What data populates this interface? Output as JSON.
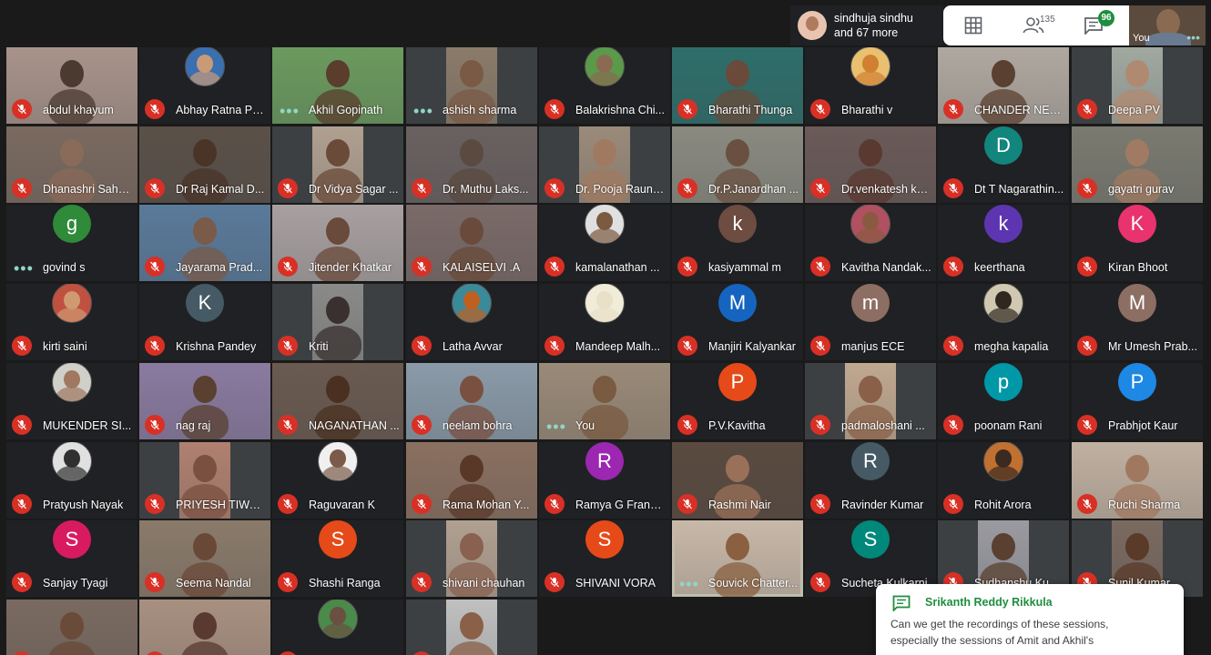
{
  "topbar": {
    "presenter_name": "sindhuja sindhu",
    "presenter_more": "and 67 more",
    "participants_count": "135",
    "chat_badge": "96",
    "self_label": "You"
  },
  "colors": {
    "mic_off": "#d93025",
    "speaking_outline": "#8fd6c6",
    "chat_green": "#1e8e3e"
  },
  "tiles": [
    {
      "name": "abdul khayum",
      "status": "muted",
      "kind": "video",
      "bg": "#a8938a",
      "skin": "#4a3a30"
    },
    {
      "name": "Abhay Ratna Pa...",
      "status": "muted",
      "kind": "image",
      "fg": "#c99a78",
      "bg": "#3a6fb0"
    },
    {
      "name": "Akhil Gopinath",
      "status": "active",
      "kind": "video",
      "bg": "#6b9a5e",
      "skin": "#5a3d2c"
    },
    {
      "name": "ashish sharma",
      "status": "active",
      "kind": "video",
      "bg": "#8a7b6a",
      "skin": "#7a5a45",
      "narrow": true
    },
    {
      "name": "Balakrishna Chi...",
      "status": "muted",
      "kind": "image",
      "fg": "#8a6a50",
      "bg": "#5a9a4a"
    },
    {
      "name": "Bharathi Thunga",
      "status": "muted",
      "kind": "video",
      "bg": "#2e6e6a",
      "skin": "#6a4a3a"
    },
    {
      "name": "Bharathi v",
      "status": "muted",
      "kind": "image",
      "fg": "#d08030",
      "bg": "#e8c070"
    },
    {
      "name": "CHANDER NEN...",
      "status": "muted",
      "kind": "video",
      "bg": "#b0a8a0",
      "skin": "#5a4030"
    },
    {
      "name": "Deepa PV",
      "status": "muted",
      "kind": "video",
      "bg": "#a0a8a0",
      "skin": "#b08a70",
      "narrow": true
    },
    {
      "name": "Dhanashri Saha...",
      "status": "muted",
      "kind": "video",
      "bg": "#7a6a60",
      "skin": "#8a6a58"
    },
    {
      "name": "Dr Raj Kamal D...",
      "status": "muted",
      "kind": "video",
      "bg": "#5a5048",
      "skin": "#4a3428"
    },
    {
      "name": "Dr Vidya Sagar ...",
      "status": "muted",
      "kind": "video",
      "bg": "#b0a090",
      "skin": "#6a4a38",
      "narrow": true
    },
    {
      "name": "Dr. Muthu Laks...",
      "status": "muted",
      "kind": "video",
      "bg": "#6a6060",
      "skin": "#5a4a40"
    },
    {
      "name": "Dr. Pooja Raund...",
      "status": "muted",
      "kind": "video",
      "bg": "#9a8a7a",
      "skin": "#a07a60",
      "narrow": true
    },
    {
      "name": "Dr.P.Janardhan ...",
      "status": "muted",
      "kind": "video",
      "bg": "#8a8a80",
      "skin": "#6a5040"
    },
    {
      "name": "Dr.venkatesh ku...",
      "status": "muted",
      "kind": "video",
      "bg": "#6a5a58",
      "skin": "#5a3a30"
    },
    {
      "name": "Dt T Nagarathin...",
      "status": "muted",
      "kind": "letter",
      "letter": "D",
      "color": "#12857d"
    },
    {
      "name": "gayatri gurav",
      "status": "muted",
      "kind": "video",
      "bg": "#7a7a70",
      "skin": "#a07a62"
    },
    {
      "name": "govind s",
      "status": "active",
      "kind": "letter",
      "letter": "g",
      "color": "#2f8a3a"
    },
    {
      "name": "Jayarama Prad...",
      "status": "muted",
      "kind": "video",
      "bg": "#5a7a9a",
      "skin": "#7a5a48"
    },
    {
      "name": "Jitender Khatkar",
      "status": "muted",
      "kind": "video",
      "bg": "#a8a0a0",
      "skin": "#6a4a3a"
    },
    {
      "name": "KALAISELVI .A",
      "status": "muted",
      "kind": "video",
      "bg": "#7a6a68",
      "skin": "#6a4a3a"
    },
    {
      "name": "kamalanathan ...",
      "status": "muted",
      "kind": "image",
      "fg": "#7a5a40",
      "bg": "#e0e0e0"
    },
    {
      "name": "kasiyammal m",
      "status": "muted",
      "kind": "letter",
      "letter": "k",
      "color": "#6d4c41"
    },
    {
      "name": "Kavitha Nandak...",
      "status": "muted",
      "kind": "image",
      "fg": "#8a5a40",
      "bg": "#b05060"
    },
    {
      "name": "keerthana",
      "status": "muted",
      "kind": "letter",
      "letter": "k",
      "color": "#5e35b1"
    },
    {
      "name": "Kiran Bhoot",
      "status": "muted",
      "kind": "letter",
      "letter": "K",
      "color": "#e8336e"
    },
    {
      "name": "kirti saini",
      "status": "muted",
      "kind": "image",
      "fg": "#d09a70",
      "bg": "#c05040"
    },
    {
      "name": "Krishna Pandey",
      "status": "muted",
      "kind": "letter",
      "letter": "K",
      "color": "#455a64"
    },
    {
      "name": "Kriti",
      "status": "muted",
      "kind": "video",
      "bg": "#8a8a88",
      "skin": "#3a3030",
      "narrow": true
    },
    {
      "name": "Latha Avvar",
      "status": "muted",
      "kind": "image",
      "fg": "#c06020",
      "bg": "#3a8a9a"
    },
    {
      "name": "Mandeep Malh...",
      "status": "muted",
      "kind": "image",
      "fg": "#e8e0c8",
      "bg": "#f0ecd8"
    },
    {
      "name": "Manjiri Kalyankar",
      "status": "muted",
      "kind": "letter",
      "letter": "M",
      "color": "#1565c0"
    },
    {
      "name": "manjus ECE",
      "status": "muted",
      "kind": "letter",
      "letter": "m",
      "color": "#8d6e63"
    },
    {
      "name": "megha kapalia",
      "status": "muted",
      "kind": "image",
      "fg": "#302820",
      "bg": "#d0c8b0"
    },
    {
      "name": "Mr Umesh Prab...",
      "status": "muted",
      "kind": "letter",
      "letter": "M",
      "color": "#8d6e63"
    },
    {
      "name": "MUKENDER SI...",
      "status": "muted",
      "kind": "image",
      "fg": "#a07860",
      "bg": "#d0d0c8"
    },
    {
      "name": "nag raj",
      "status": "muted",
      "kind": "video",
      "bg": "#8a7aa0",
      "skin": "#5a4030"
    },
    {
      "name": "NAGANATHAN ...",
      "status": "muted",
      "kind": "video",
      "bg": "#6a5a50",
      "skin": "#4a3020"
    },
    {
      "name": "neelam bohra",
      "status": "muted",
      "kind": "video",
      "bg": "#8a9aa8",
      "skin": "#7a5040"
    },
    {
      "name": "You",
      "status": "active",
      "kind": "video",
      "bg": "#9a8a78",
      "skin": "#7a5a40"
    },
    {
      "name": "P.V.Kavitha",
      "status": "muted",
      "kind": "letter",
      "letter": "P",
      "color": "#e64a19"
    },
    {
      "name": "padmaloshani ...",
      "status": "muted",
      "kind": "video",
      "bg": "#c0a890",
      "skin": "#8a6048",
      "narrow": true
    },
    {
      "name": "poonam Rani",
      "status": "muted",
      "kind": "letter",
      "letter": "p",
      "color": "#0097a7"
    },
    {
      "name": "Prabhjot Kaur",
      "status": "muted",
      "kind": "letter",
      "letter": "P",
      "color": "#1e88e5"
    },
    {
      "name": "Pratyush Nayak",
      "status": "muted",
      "kind": "image",
      "fg": "#303030",
      "bg": "#e0e0e0"
    },
    {
      "name": "PRIYESH TIWARI",
      "status": "muted",
      "kind": "video",
      "bg": "#b08070",
      "skin": "#7a5040",
      "narrow": true
    },
    {
      "name": "Raguvaran K",
      "status": "muted",
      "kind": "image",
      "fg": "#7a5a48",
      "bg": "#f0f0f0"
    },
    {
      "name": "Rama Mohan Y...",
      "status": "muted",
      "kind": "video",
      "bg": "#8a7060",
      "skin": "#5a3828"
    },
    {
      "name": "Ramya G Frankl...",
      "status": "muted",
      "kind": "letter",
      "letter": "R",
      "color": "#9c27b0"
    },
    {
      "name": "Rashmi Nair",
      "status": "muted",
      "kind": "video",
      "bg": "#5a4a40",
      "skin": "#9a7058"
    },
    {
      "name": "Ravinder Kumar",
      "status": "muted",
      "kind": "letter",
      "letter": "R",
      "color": "#455a64"
    },
    {
      "name": "Rohit Arora",
      "status": "muted",
      "kind": "image",
      "fg": "#3a2a20",
      "bg": "#c07030"
    },
    {
      "name": "Ruchi Sharma",
      "status": "muted",
      "kind": "video",
      "bg": "#c0b0a0",
      "skin": "#a07860"
    },
    {
      "name": "Sanjay Tyagi",
      "status": "muted",
      "kind": "letter",
      "letter": "S",
      "color": "#d81b60"
    },
    {
      "name": "Seema Nandal",
      "status": "muted",
      "kind": "video",
      "bg": "#8a7a6a",
      "skin": "#6a4838"
    },
    {
      "name": "Shashi Ranga",
      "status": "muted",
      "kind": "letter",
      "letter": "S",
      "color": "#e64a19"
    },
    {
      "name": "shivani chauhan",
      "status": "muted",
      "kind": "video",
      "bg": "#b0a090",
      "skin": "#8a6050",
      "narrow": true
    },
    {
      "name": "SHIVANI VORA",
      "status": "muted",
      "kind": "letter",
      "letter": "S",
      "color": "#e64a19"
    },
    {
      "name": "Souvick Chatter...",
      "status": "active",
      "kind": "video",
      "bg": "#c8b8a8",
      "skin": "#8a6040",
      "speaking": true
    },
    {
      "name": "Sucheta Kulkarni",
      "status": "muted",
      "kind": "letter",
      "letter": "S",
      "color": "#00897b"
    },
    {
      "name": "Sudhanshu Ku...",
      "status": "muted",
      "kind": "video",
      "bg": "#9a9aa0",
      "skin": "#5a4030",
      "narrow": true
    },
    {
      "name": "Sunil Kumar",
      "status": "muted",
      "kind": "video",
      "bg": "#7a6a60",
      "skin": "#5a3a28",
      "narrow": true
    },
    {
      "name": "",
      "status": "muted",
      "kind": "video",
      "bg": "#7a6a60",
      "skin": "#6a4a38"
    },
    {
      "name": "",
      "status": "muted",
      "kind": "video",
      "bg": "#a89080",
      "skin": "#5a3a30"
    },
    {
      "name": "",
      "status": "muted",
      "kind": "image",
      "fg": "#6a5040",
      "bg": "#4a8a4a"
    },
    {
      "name": "",
      "status": "muted",
      "kind": "video",
      "bg": "#c0c0c0",
      "skin": "#8a6048",
      "narrow": true
    },
    {
      "name": "",
      "status": "none",
      "kind": "empty"
    },
    {
      "name": "",
      "status": "none",
      "kind": "empty"
    },
    {
      "name": "",
      "status": "none",
      "kind": "empty"
    },
    {
      "name": "",
      "status": "none",
      "kind": "empty"
    },
    {
      "name": "",
      "status": "none",
      "kind": "empty"
    }
  ],
  "chat": {
    "sender": "Srikanth Reddy Rikkula",
    "line1": "Can we get the recordings of these sessions,",
    "line2": "especially the sessions of Amit and Akhil's"
  }
}
